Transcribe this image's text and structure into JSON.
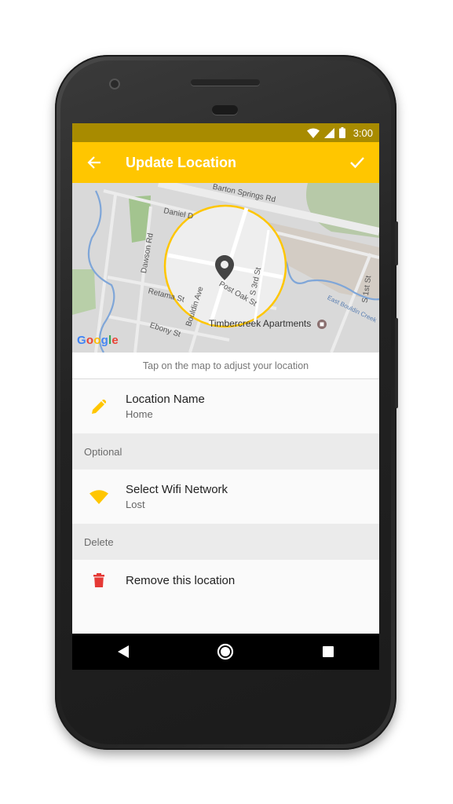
{
  "status_bar": {
    "time": "3:00"
  },
  "app_bar": {
    "title": "Update Location"
  },
  "map": {
    "labels": {
      "barton_springs": "Barton Springs Rd",
      "daniel": "Daniel D",
      "dawson": "Dawson Rd",
      "retama": "Retama St",
      "bouldin": "Bouldin Ave",
      "post_oak": "Post Oak St",
      "s3rd": "S 3rd St",
      "ebony": "Ebony St",
      "s1st": "S 1st St",
      "east_bouldin": "East Bouldin Creek",
      "timbercreek": "Timbercreek Apartments"
    },
    "google": [
      "G",
      "o",
      "o",
      "g",
      "l",
      "e"
    ]
  },
  "hint": "Tap on the map to adjust your location",
  "location_name": {
    "label": "Location Name",
    "value": "Home"
  },
  "section_optional": "Optional",
  "wifi": {
    "label": "Select Wifi Network",
    "value": "Lost"
  },
  "section_delete": "Delete",
  "remove": {
    "label": "Remove this location"
  },
  "colors": {
    "accent": "#ffc600",
    "status_bar": "#a88b00",
    "delete_red": "#e53935",
    "google": [
      "#4285f4",
      "#ea4335",
      "#fbbc05",
      "#4285f4",
      "#34a853",
      "#ea4335"
    ]
  },
  "icons": {
    "back": "arrow-left-icon",
    "confirm": "check-icon",
    "edit": "pencil-icon",
    "wifi": "wifi-icon",
    "delete": "trash-icon",
    "location": "map-pin-icon"
  }
}
